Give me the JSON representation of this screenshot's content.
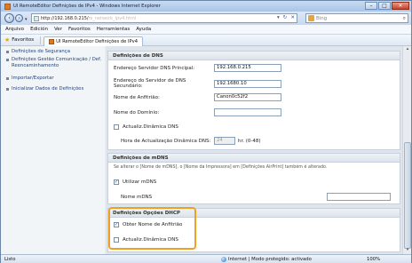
{
  "window": {
    "title": "UI RemoteEditor Definições de IPv4 - Windows Internet Explorer"
  },
  "address": {
    "url_visible": "http://192.168.0.215/",
    "url_blurred": "rs_network_ipv4.html",
    "search_placeholder": "Bing"
  },
  "menu": [
    "Arquivo",
    "Edición",
    "Ver",
    "Favoritos",
    "Herramientas",
    "Ayuda"
  ],
  "favorites": {
    "label": "Favoritos",
    "tab_title": "UI RemoteEditor Definições de IPv4"
  },
  "sidebar": {
    "items": [
      {
        "label": "Definições de Segurança"
      },
      {
        "label": "Definições Gestão Comunicação / Def. Reencaminhamento"
      },
      {
        "label": "Importar/Exportar"
      },
      {
        "label": "Inicializar Dados de Definições"
      }
    ]
  },
  "dns": {
    "heading": "Definições de DNS",
    "primary_label": "Endereço Servidor DNS Principal:",
    "primary_value": "192.168.0.215",
    "secondary_label": "Endereço do Servidor de DNS Secundário:",
    "secondary_value": "192.1680.10",
    "host_label": "Nome de Anfitrião:",
    "host_value": "Canon0c52f2",
    "domain_label": "Nome do Domínio:",
    "domain_value": "",
    "dyn_label": "Actualiz.Dinâmica DNS",
    "interval_label": "Hora de Actualização Dinâmica DNS:",
    "interval_value": "24",
    "interval_unit": "hr. (0-48)"
  },
  "mdns": {
    "heading": "Definições de mDNS",
    "note": "Se alterar o [Nome de mDNS], o [Nome da Impressora] em [Definições AirPrint] também é alterado.",
    "use_label": "Utilizar mDNS",
    "name_label": "Nome mDNS"
  },
  "dhcp": {
    "heading": "Definições Opções DHCP",
    "host_label": "Obter Nome de Anfitrião",
    "dyn_label": "Actualiz.Dinâmica DNS"
  },
  "status": {
    "left": "Listo",
    "zone": "Internet | Modo protegido: activado",
    "zoom": "100%"
  }
}
